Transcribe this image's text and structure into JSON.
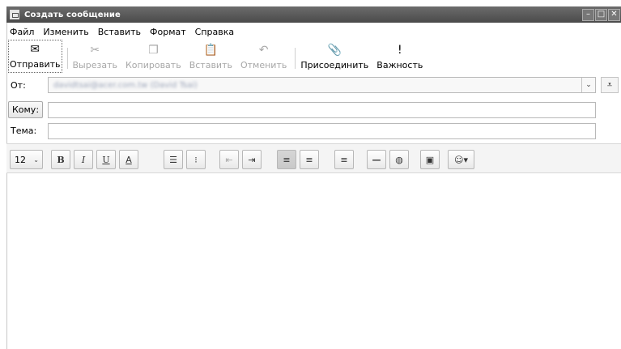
{
  "window": {
    "title": "Создать сообщение"
  },
  "menu": [
    "Файл",
    "Изменить",
    "Вставить",
    "Формат",
    "Справка"
  ],
  "toolbar": {
    "send": "Отправить",
    "cut": "Вырезать",
    "copy": "Копировать",
    "paste": "Вставить",
    "undo": "Отменить",
    "attach": "Присоединить",
    "priority": "Важность"
  },
  "fields": {
    "from_label": "От:",
    "from_value": "davidtsai@acer.com.tw (David Tsai)",
    "to_button": "Кому:",
    "to_value": "",
    "subject_label": "Тема:",
    "subject_value": ""
  },
  "format": {
    "font_size": "12",
    "bold": "B",
    "italic": "I",
    "underline": "U",
    "font_color": "A"
  },
  "colors": {
    "titlebar": "#5a5a5a",
    "disabled_text": "#a8a8a8"
  }
}
